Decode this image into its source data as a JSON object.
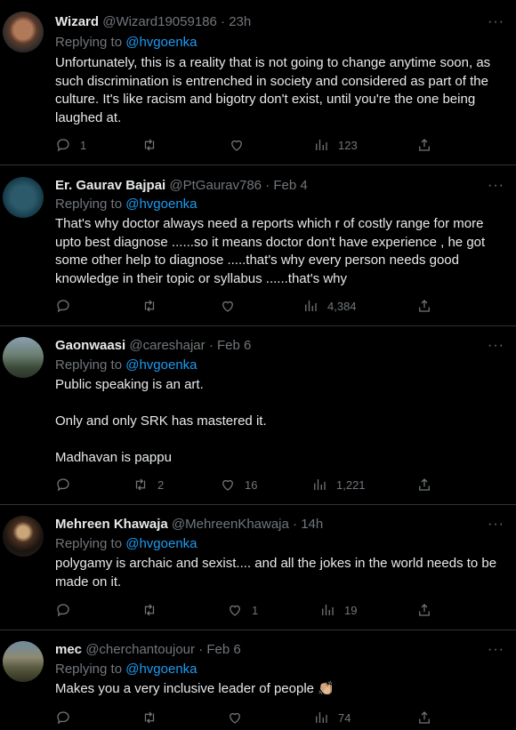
{
  "tweets": [
    {
      "name": "Wizard",
      "handle": "@Wizard19059186",
      "time": "· 23h",
      "replying_prefix": "Replying to ",
      "replying_to": "@hvgoenka",
      "paragraphs": [
        "Unfortunately, this is a reality that is not going to change anytime soon, as such discrimination is entrenched in society and considered as part of the culture. It's like racism and bigotry don't exist, until you're the one being laughed at."
      ],
      "replies": "1",
      "retweets": "",
      "likes": "",
      "views": "123"
    },
    {
      "name": "Er. Gaurav Bajpai",
      "handle": "@PtGaurav786",
      "time": "· Feb 4",
      "replying_prefix": "Replying to ",
      "replying_to": "@hvgoenka",
      "paragraphs": [
        "That's why doctor always need a reports which r of costly range for more upto best diagnose ......so it means doctor don't have experience , he got some other help to diagnose .....that's why every person needs good knowledge in their topic or syllabus ......that's why"
      ],
      "replies": "",
      "retweets": "",
      "likes": "",
      "views": "4,384"
    },
    {
      "name": "Gaonwaasi",
      "handle": "@careshajar",
      "time": "· Feb 6",
      "replying_prefix": "Replying to ",
      "replying_to": "@hvgoenka",
      "paragraphs": [
        "Public speaking is an art.",
        "Only and only SRK has mastered it.",
        "Madhavan is pappu"
      ],
      "replies": "",
      "retweets": "2",
      "likes": "16",
      "views": "1,221"
    },
    {
      "name": "Mehreen Khawaja",
      "handle": "@MehreenKhawaja",
      "time": "· 14h",
      "replying_prefix": "Replying to ",
      "replying_to": "@hvgoenka",
      "paragraphs": [
        "polygamy is archaic and sexist.... and all the jokes in the world needs to be made on it."
      ],
      "replies": "",
      "retweets": "",
      "likes": "1",
      "views": "19"
    },
    {
      "name": "mec",
      "handle": "@cherchantoujour",
      "time": "· Feb 6",
      "replying_prefix": "Replying to ",
      "replying_to": "@hvgoenka",
      "paragraphs": [
        "Makes you a very inclusive leader of people 👏🏼"
      ],
      "replies": "",
      "retweets": "",
      "likes": "",
      "views": "74"
    }
  ],
  "more_glyph": "···",
  "icons": [
    "reply-icon",
    "retweet-icon",
    "like-icon",
    "views-icon",
    "share-icon",
    "more-icon"
  ]
}
